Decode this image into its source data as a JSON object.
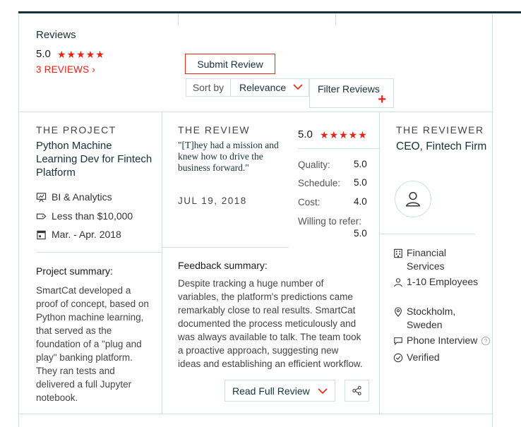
{
  "header": {
    "title": "Reviews",
    "rating": "5.0",
    "stars": "★★★★★",
    "reviews_link": "3 REVIEWS ›"
  },
  "toolbar": {
    "submit_label": "Submit Review",
    "sort_label": "Sort by",
    "sort_value": "Relevance",
    "filter_label": "Filter Reviews",
    "filter_plus": "+"
  },
  "project": {
    "section_label": "THE PROJECT",
    "title": "Python Machine Learning Dev for Fintech Platform",
    "category": "BI & Analytics",
    "budget": "Less than $10,000",
    "dates": "Mar. - Apr. 2018",
    "summary_heading": "Project summary:",
    "summary": "SmartCat developed a proof of concept, based on Python machine learning, that served as the foundation of a \"plug and play\" banking platform. They ran tests and delivered a full Jupyter notebook."
  },
  "review": {
    "section_label": "THE REVIEW",
    "quote": "\"[T]hey had a mission and knew how to drive the business forward.\"",
    "date": "JUL 19, 2018",
    "overall": "5.0",
    "stars": "★★★★★",
    "scores": [
      {
        "label": "Quality:",
        "value": "5.0"
      },
      {
        "label": "Schedule:",
        "value": "5.0"
      },
      {
        "label": "Cost:",
        "value": "4.0"
      }
    ],
    "refer_label": "Willing to refer:",
    "refer_value": "5.0",
    "feedback_heading": "Feedback summary:",
    "feedback": "Despite tracking a huge number of variables, the platform's predictions came remarkably close to real results. SmartCat documented the process meticulously and was always available to talk. The team took a proactive approach, suggesting new ideas and establishing an efficient workflow.",
    "read_label": "Read Full Review"
  },
  "reviewer": {
    "section_label": "THE REVIEWER",
    "name": "CEO, Fintech Firm",
    "industry": "Financial Services",
    "size": "1-10 Employees",
    "location": "Stockholm, Sweden",
    "interview": "Phone Interview",
    "verified": "Verified"
  },
  "colors": {
    "accent": "#e62415",
    "navy": "#17313b",
    "border": "#cfe0e7"
  }
}
